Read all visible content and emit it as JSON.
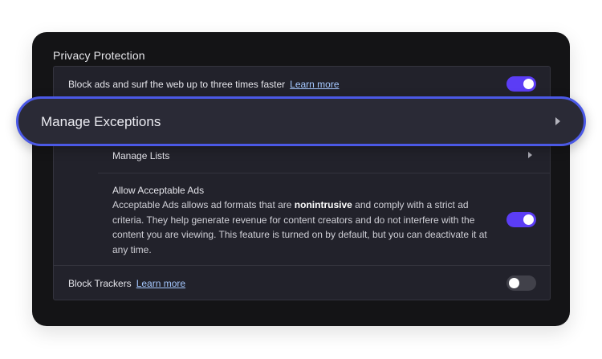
{
  "section": {
    "title": "Privacy Protection"
  },
  "block_ads": {
    "label": "Block ads and surf the web up to three times faster",
    "link": "Learn more",
    "enabled": true
  },
  "manage_exceptions": {
    "label": "Manage Exceptions"
  },
  "manage_lists": {
    "label": "Manage Lists"
  },
  "acceptable_ads": {
    "title": "Allow Acceptable Ads",
    "desc_before": "Acceptable Ads allows ad formats that are ",
    "desc_bold": "nonintrusive",
    "desc_after": " and comply with a strict ad criteria. They help generate revenue for content creators and do not interfere with the content you are viewing. This feature is turned on by default, but you can deactivate it at any time.",
    "enabled": true
  },
  "block_trackers": {
    "label": "Block Trackers",
    "link": "Learn more",
    "enabled": false
  },
  "colors": {
    "toggle_on": "#5b3df5",
    "highlight_border": "#4b59e6",
    "link": "#a5c8ff"
  }
}
